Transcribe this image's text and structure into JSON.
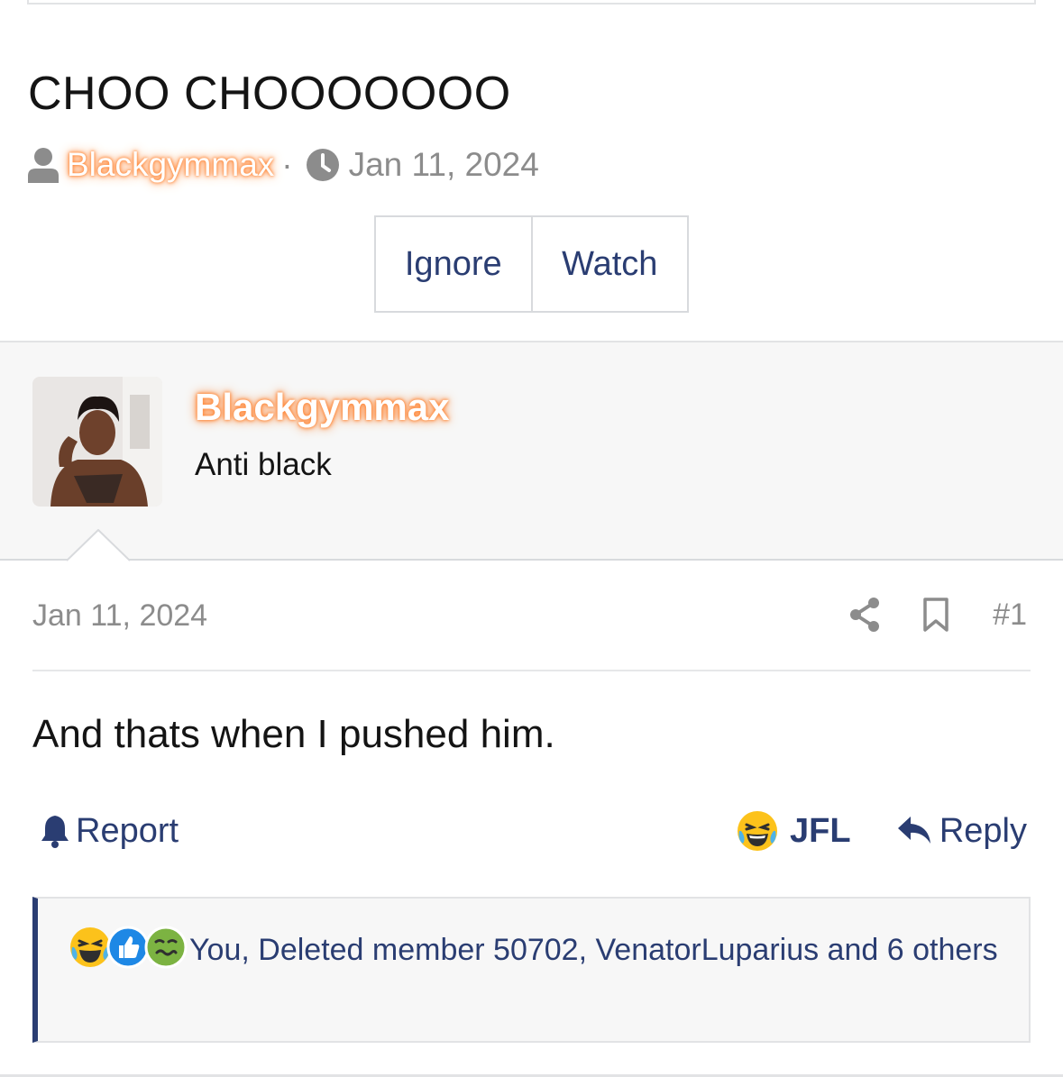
{
  "thread": {
    "title": "CHOO CHOOOOOOO",
    "author": "Blackgymmax",
    "separator": "·",
    "date": "Jan 11, 2024",
    "ignore_label": "Ignore",
    "watch_label": "Watch"
  },
  "post": {
    "username": "Blackgymmax",
    "user_title": "Anti black",
    "date": "Jan 11, 2024",
    "number": "#1",
    "body": "And thats when I pushed him.",
    "report_label": "Report",
    "reaction_label": "JFL",
    "reply_label": "Reply",
    "reactions_summary": "You, Deleted member 50702, VenatorLuparius and 6 others"
  },
  "colors": {
    "link": "#2a3d72",
    "glow": "#ff8a3d",
    "muted": "#8c8c8c"
  },
  "icons": [
    "user-icon",
    "clock-icon",
    "share-icon",
    "bookmark-icon",
    "bell-icon",
    "laughing-emoji-icon",
    "like-icon",
    "nauseated-emoji-icon",
    "reply-arrow-icon"
  ]
}
